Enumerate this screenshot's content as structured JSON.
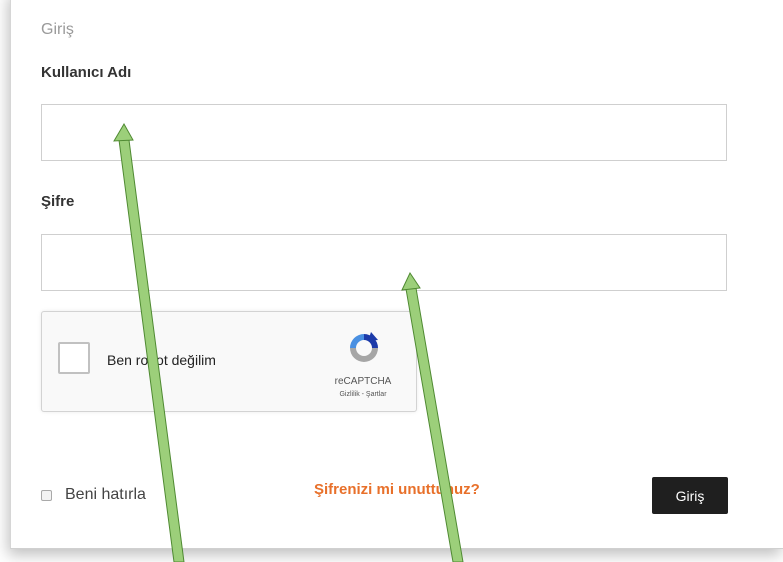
{
  "form": {
    "section_title": "Giriş",
    "username_label": "Kullanıcı Adı",
    "username_value": "",
    "password_label": "Şifre",
    "password_value": ""
  },
  "captcha": {
    "checkbox_label": "Ben robot değilim",
    "brand": "reCAPTCHA",
    "links": "Gizlilik - Şartlar"
  },
  "footer": {
    "remember_label": "Beni hatırla",
    "forgot_link": "Şifrenizi mi unuttunuz?",
    "submit_label": "Giriş"
  },
  "colors": {
    "forgot_link": "#e8702a",
    "submit_button": "#1f1f1f",
    "annotation_arrow": "#9ccf7a"
  }
}
